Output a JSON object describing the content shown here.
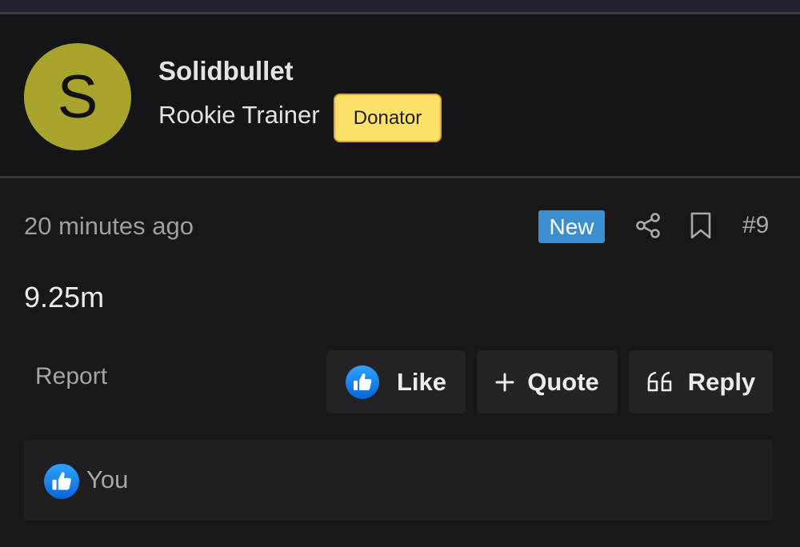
{
  "author": {
    "avatar_letter": "S",
    "avatar_color": "#a8a42e",
    "username": "Solidbullet",
    "title": "Rookie Trainer",
    "badge": "Donator",
    "badge_color": "#fde26a"
  },
  "post": {
    "time": "20 minutes ago",
    "new_badge": "New",
    "new_badge_color": "#3d8ed0",
    "number": "#9",
    "content": "9.25m",
    "share_icon": "share-icon",
    "bookmark_icon": "bookmark-icon"
  },
  "actions": {
    "report": "Report",
    "like": "Like",
    "quote": "Quote",
    "reply": "Reply",
    "like_icon": "thumbs-up-icon",
    "quote_icon": "plus-icon",
    "reply_icon": "quote-marks-icon"
  },
  "reactions": {
    "icon": "thumbs-up-icon",
    "users": "You"
  }
}
